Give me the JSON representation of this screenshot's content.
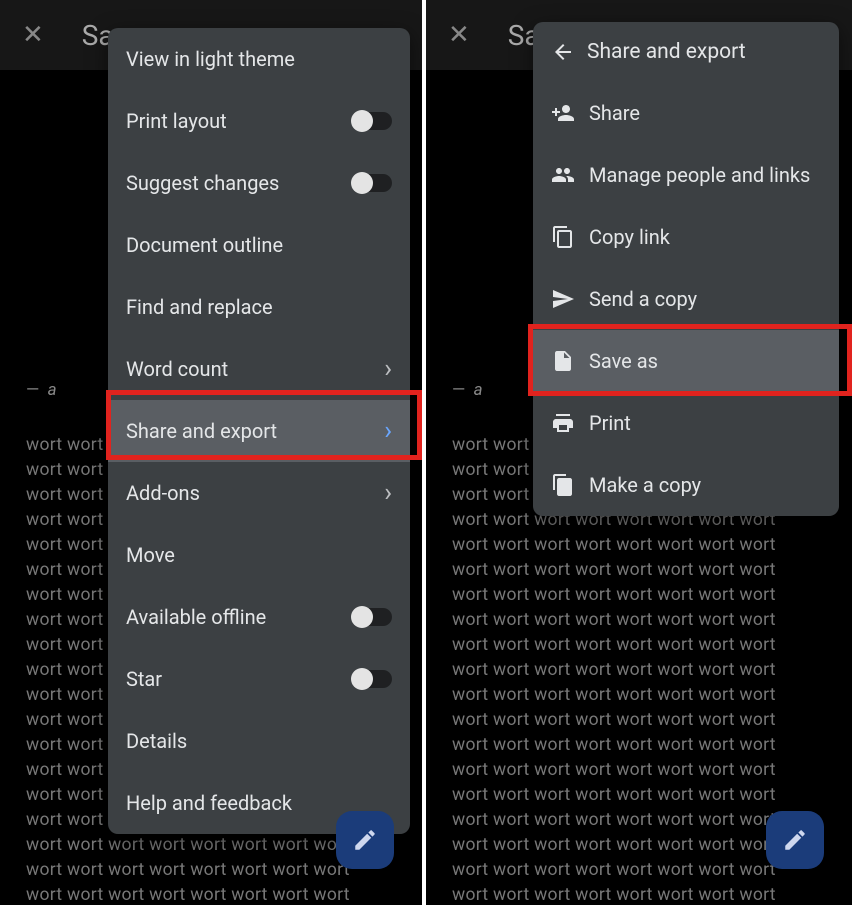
{
  "topbar": {
    "title_fragment": "Sa"
  },
  "doc": {
    "quote": "a",
    "word": "wort"
  },
  "menu1": {
    "items": [
      {
        "label": "View in light theme",
        "type": "plain"
      },
      {
        "label": "Print layout",
        "type": "toggle"
      },
      {
        "label": "Suggest changes",
        "type": "toggle"
      },
      {
        "label": "Document outline",
        "type": "plain"
      },
      {
        "label": "Find and replace",
        "type": "plain"
      },
      {
        "label": "Word count",
        "type": "chev"
      },
      {
        "label": "Share and export",
        "type": "chev-blue",
        "highlight": true
      },
      {
        "label": "Add-ons",
        "type": "chev"
      },
      {
        "label": "Move",
        "type": "plain"
      },
      {
        "label": "Available offline",
        "type": "toggle"
      },
      {
        "label": "Star",
        "type": "toggle"
      },
      {
        "label": "Details",
        "type": "plain"
      },
      {
        "label": "Help and feedback",
        "type": "plain"
      }
    ]
  },
  "menu2": {
    "header": "Share and export",
    "items": [
      {
        "label": "Share",
        "icon": "person-add-icon"
      },
      {
        "label": "Manage people and links",
        "icon": "people-icon"
      },
      {
        "label": "Copy link",
        "icon": "copy-icon"
      },
      {
        "label": "Send a copy",
        "icon": "send-icon"
      },
      {
        "label": "Save as",
        "icon": "file-icon",
        "highlight": true
      },
      {
        "label": "Print",
        "icon": "print-icon"
      },
      {
        "label": "Make a copy",
        "icon": "duplicate-icon"
      }
    ]
  }
}
